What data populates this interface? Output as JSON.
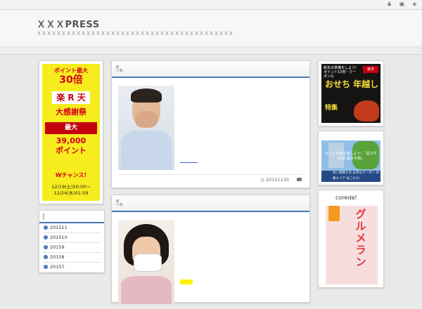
{
  "header": {
    "site_title": "ＸＸＸPRESS",
    "site_description": "ＸＸＸＸＸＸＸＸＸＸＸＸＸＸＸＸＸＸＸＸＸＸＸＸＸＸＸＸＸＸＸＸＸＸＸＸＸＸＸＸ"
  },
  "top_icons": [
    "user-icon",
    "lock-icon",
    "rss-icon"
  ],
  "left_ad": {
    "line1": "ポイント最大",
    "line2": "30倍",
    "logo": "楽 R 天",
    "line3": "大感謝祭",
    "line4": "最大",
    "line5": "39,000",
    "line6": "ポイント",
    "line7": "Wチャンス!",
    "line8": "12/19(土)20:00〜",
    "line9": "12/24(木)01:59"
  },
  "archive": {
    "items": [
      "201511",
      "201510",
      "20159",
      "20158",
      "20157"
    ]
  },
  "posts": [
    {
      "date": "20151130"
    },
    {}
  ],
  "right_ads": {
    "osechi_small": "新年の準備をしよう! ポイント10倍・クーポンも",
    "osechi_badge": "楽天",
    "osechi_big": "おせち 年越し",
    "osechi_small2": "特集",
    "travel_text": "もっと日本を旅しよう! 「近江牛30倍 最大半額」",
    "travel_bottom": "早い者勝ちの お得なクーポン 対象エリア はこちら!",
    "gourmet_brand": "coreda!",
    "gourmet_title": "グルメラン"
  }
}
